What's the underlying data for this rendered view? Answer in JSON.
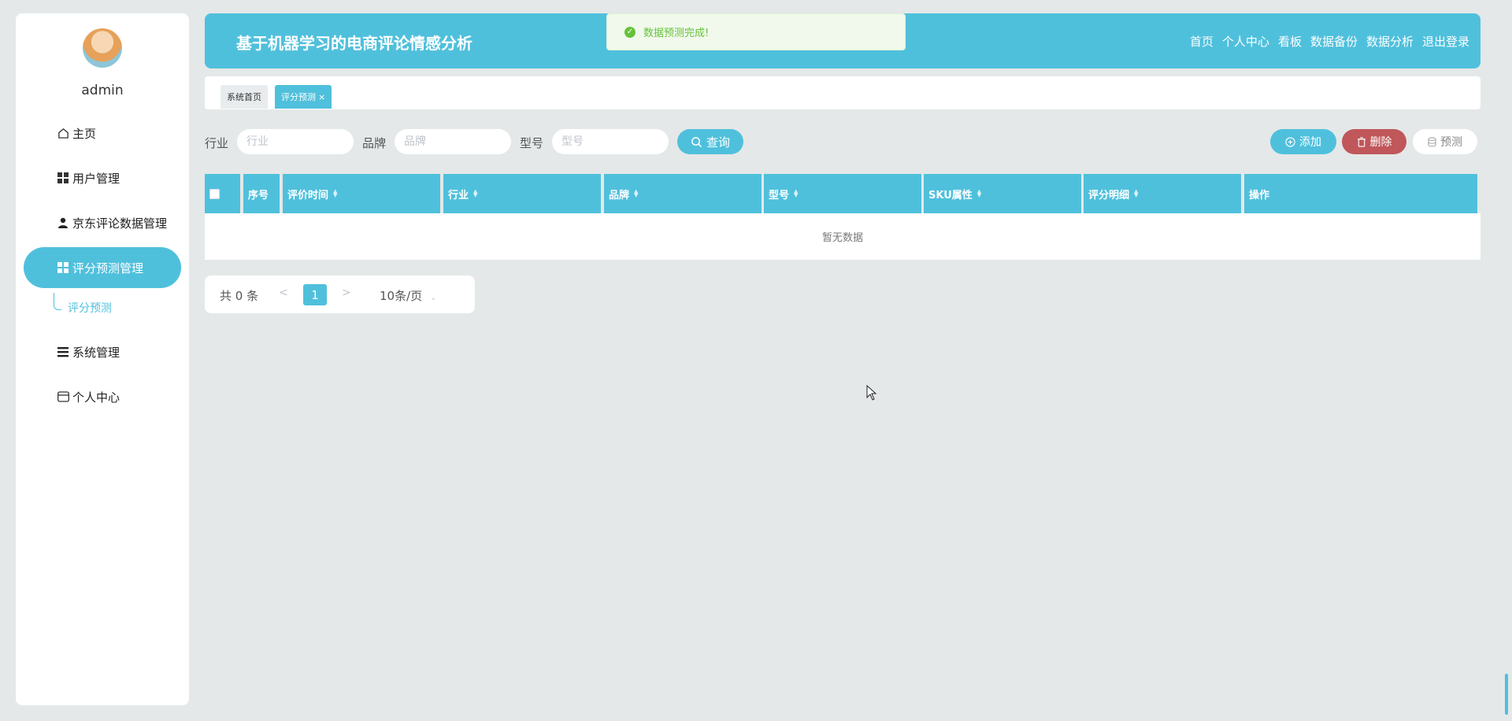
{
  "user": {
    "name": "admin"
  },
  "header": {
    "title": "基于机器学习的电商评论情感分析"
  },
  "topnav": [
    "首页",
    "个人中心",
    "看板",
    "数据备份",
    "数据分析",
    "退出登录"
  ],
  "toast": {
    "message": "数据预测完成!"
  },
  "sidebar": {
    "items": [
      {
        "label": "主页",
        "icon": "home-icon"
      },
      {
        "label": "用户管理",
        "icon": "grid-icon"
      },
      {
        "label": "京东评论数据管理",
        "icon": "person-icon"
      },
      {
        "label": "评分预测管理",
        "icon": "grid-icon",
        "active": true
      },
      {
        "label": "系统管理",
        "icon": "list-icon"
      },
      {
        "label": "个人中心",
        "icon": "card-icon"
      }
    ],
    "subitem": "评分预测"
  },
  "tabs": {
    "home": "系统首页",
    "current": "评分预测",
    "close": "×"
  },
  "search": {
    "industry_label": "行业",
    "industry_placeholder": "行业",
    "brand_label": "品牌",
    "brand_placeholder": "品牌",
    "model_label": "型号",
    "model_placeholder": "型号",
    "query_label": "查询"
  },
  "actions": {
    "add": "添加",
    "delete": "删除",
    "predict": "预测"
  },
  "table": {
    "columns": [
      "序号",
      "评价时间",
      "行业",
      "品牌",
      "型号",
      "SKU属性",
      "评分明细",
      "操作"
    ],
    "empty": "暂无数据"
  },
  "pagination": {
    "total": "共 0 条",
    "page": "1",
    "page_size": "10条/页",
    "prev": "<",
    "next": ">"
  },
  "colors": {
    "accent": "#4fc0dc",
    "danger": "#c0575a",
    "success": "#67c23a"
  }
}
